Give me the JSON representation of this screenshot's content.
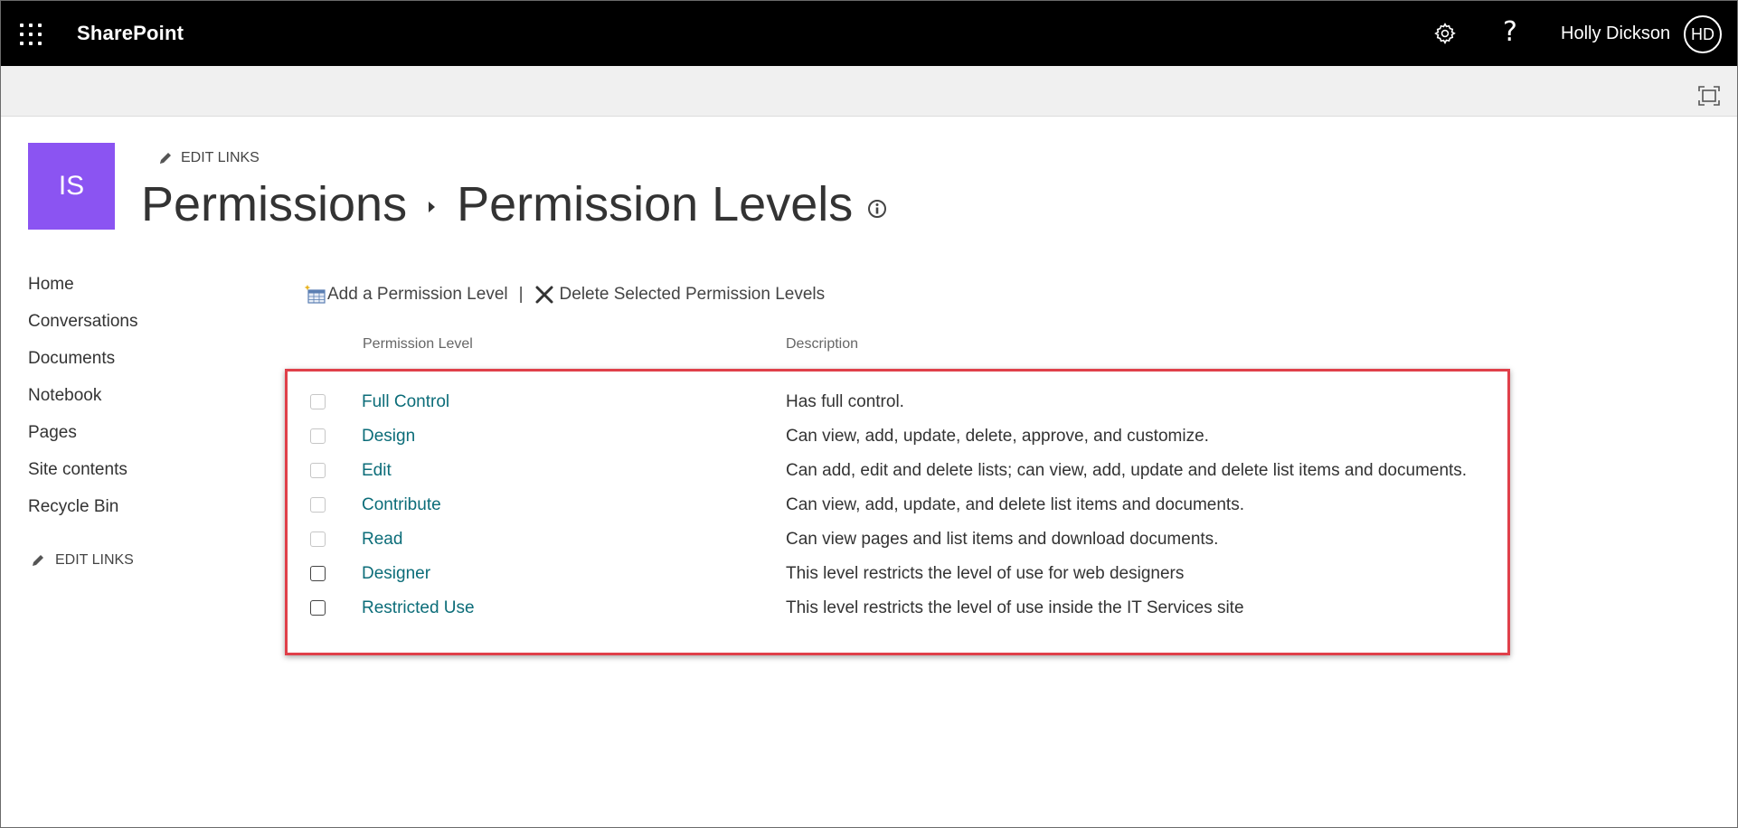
{
  "suite_bar": {
    "app_name": "SharePoint",
    "help_glyph": "?",
    "user_name": "Holly Dickson",
    "user_initials": "HD",
    "icons": [
      "app-launcher-icon",
      "settings-gear-icon",
      "help-icon"
    ]
  },
  "ribbon": {
    "icons": [
      "focus-mode-icon"
    ]
  },
  "site": {
    "logo_initials": "IS",
    "logo_color": "#8b54f2",
    "edit_links_label": "EDIT LINKS"
  },
  "breadcrumb": {
    "parent": "Permissions",
    "current": "Permission Levels"
  },
  "left_nav": {
    "items": [
      {
        "label": "Home"
      },
      {
        "label": "Conversations"
      },
      {
        "label": "Documents"
      },
      {
        "label": "Notebook"
      },
      {
        "label": "Pages"
      },
      {
        "label": "Site contents"
      },
      {
        "label": "Recycle Bin"
      }
    ],
    "edit_links_label": "EDIT LINKS"
  },
  "toolbar": {
    "add_label": "Add a Permission Level",
    "separator": "|",
    "delete_label": "Delete Selected Permission Levels"
  },
  "table": {
    "headers": {
      "level": "Permission Level",
      "description": "Description"
    },
    "rows": [
      {
        "name": "Full Control",
        "description": "Has full control.",
        "checkbox_enabled": false
      },
      {
        "name": "Design",
        "description": "Can view, add, update, delete, approve, and customize.",
        "checkbox_enabled": false
      },
      {
        "name": "Edit",
        "description": "Can add, edit and delete lists; can view, add, update and delete list items and documents.",
        "checkbox_enabled": false
      },
      {
        "name": "Contribute",
        "description": "Can view, add, update, and delete list items and documents.",
        "checkbox_enabled": false
      },
      {
        "name": "Read",
        "description": "Can view pages and list items and download documents.",
        "checkbox_enabled": false
      },
      {
        "name": "Designer",
        "description": "This level restricts the level of use for web designers",
        "checkbox_enabled": true
      },
      {
        "name": "Restricted Use",
        "description": "This level restricts the level of use inside the IT Services site",
        "checkbox_enabled": true
      }
    ]
  },
  "colors": {
    "suite_bar": "#000000",
    "link": "#0c6d79",
    "highlight_border": "#e0404a"
  }
}
